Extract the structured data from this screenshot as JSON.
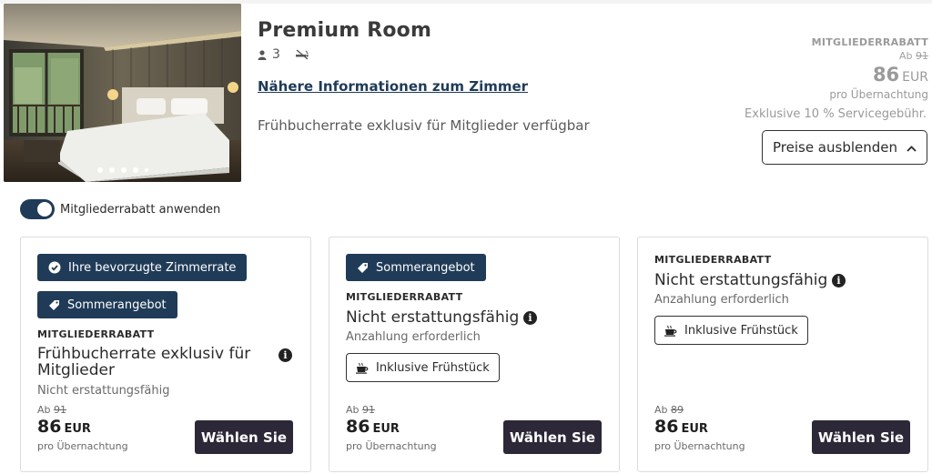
{
  "room": {
    "title": "Premium Room",
    "guests": "3",
    "link_label": "Nähere Informationen zum Zimmer",
    "description": "Frühbucherrate exklusiv für Mitglieder verfügbar",
    "carousel_dots": 5
  },
  "summary_price": {
    "badge": "MITGLIEDERRABATT",
    "from_label": "Ab",
    "old_price": "91",
    "price": "86",
    "currency": "EUR",
    "per_night": "pro Übernachtung",
    "fee_note": "Exklusive 10 % Servicegebühr.",
    "toggle_button_label": "Preise ausblenden"
  },
  "member_toggle": {
    "label": "Mitgliederrabatt anwenden",
    "on": true
  },
  "rates": [
    {
      "tags": [
        "Ihre bevorzugte Zimmerrate",
        "Sommerangebot"
      ],
      "badge": "MITGLIEDERRABATT",
      "name_line1": "Frühbucherrate exklusiv für",
      "name_line2": "Mitglieder",
      "sub": "Nicht erstattungsfähig",
      "from_label": "Ab",
      "old_price": "91",
      "price": "86",
      "currency": "EUR",
      "per_night": "pro Übernachtung",
      "button": "Wählen Sie"
    },
    {
      "tags": [
        "Sommerangebot"
      ],
      "badge": "MITGLIEDERRABATT",
      "name": "Nicht erstattungsfähig",
      "sub": "Anzahlung erforderlich",
      "extra": "Inklusive Frühstück",
      "from_label": "Ab",
      "old_price": "91",
      "price": "86",
      "currency": "EUR",
      "per_night": "pro Übernachtung",
      "button": "Wählen Sie"
    },
    {
      "badge": "MITGLIEDERRABATT",
      "name": "Nicht erstattungsfähig",
      "sub": "Anzahlung erforderlich",
      "extra": "Inklusive Frühstück",
      "from_label": "Ab",
      "old_price": "89",
      "price": "86",
      "currency": "EUR",
      "per_night": "pro Übernachtung",
      "button": "Wählen Sie"
    }
  ],
  "icons": {
    "guests": "person-icon",
    "no_smoking": "no-smoking-icon",
    "info": "info-icon",
    "preferred": "check-circle-icon",
    "offer": "tag-icon",
    "breakfast": "coffee-cup-icon",
    "collapse": "chevron-up-icon"
  },
  "colors": {
    "brand_navy": "#1f3b57",
    "button_dark": "#2c2838",
    "muted_text": "#9a9a9a"
  }
}
